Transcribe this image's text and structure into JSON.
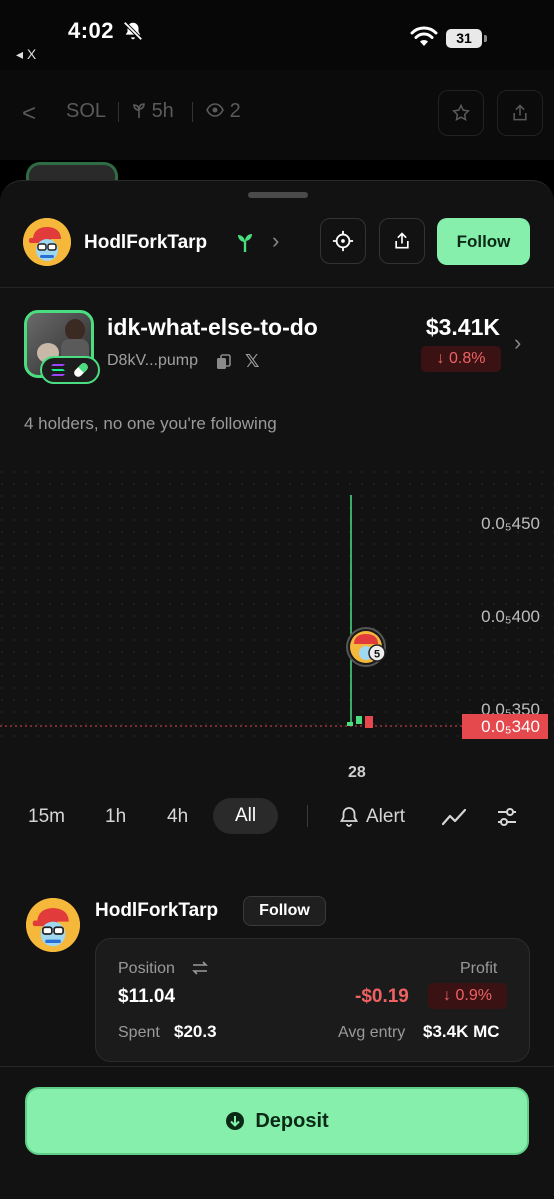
{
  "status_bar": {
    "time": "4:02",
    "back_app": "◂ X",
    "battery": "31"
  },
  "background_header": {
    "back": "<",
    "symbol": "SOL",
    "age": "5h",
    "views": "2"
  },
  "trader": {
    "name": "HodlForkTarp",
    "follow_label": "Follow"
  },
  "token": {
    "name": "idk-what-else-to-do",
    "address": "D8kV...pump",
    "market_cap": "$3.41K",
    "change": "↓ 0.8%"
  },
  "holders_text": "4 holders, no one you're following",
  "chart_data": {
    "type": "candlestick",
    "y_ticks": [
      "0.0₅450",
      "0.0₅400",
      "0.0₅350"
    ],
    "current_price_label": "0.0₅340",
    "x_labels": [
      "28"
    ],
    "trader_marker_count": "5"
  },
  "timeframes": {
    "tf_15m": "15m",
    "tf_1h": "1h",
    "tf_4h": "4h",
    "tf_all": "All",
    "alert": "Alert"
  },
  "position": {
    "trader_name": "HodlForkTarp",
    "follow_label": "Follow",
    "position_label": "Position",
    "position_value": "$11.04",
    "profit_label": "Profit",
    "profit_value": "-$0.19",
    "profit_pct": "↓ 0.9%",
    "spent_label": "Spent",
    "spent_value": "$20.3",
    "avg_entry_label": "Avg entry",
    "avg_entry_value": "$3.4K MC"
  },
  "footer": {
    "deposit_label": "Deposit"
  },
  "colors": {
    "accent_green": "#86efac",
    "negative_red": "#f06262",
    "price_line_red": "#e5484d"
  }
}
